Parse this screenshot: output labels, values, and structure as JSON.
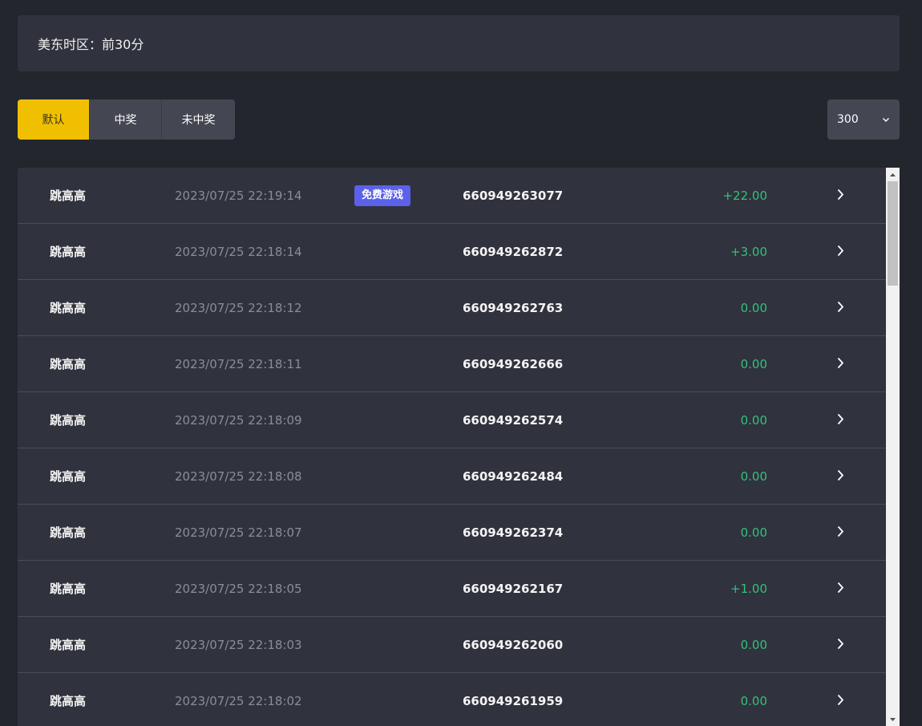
{
  "header": {
    "timezone_label": "美东时区：前30分"
  },
  "filters": {
    "tabs": [
      {
        "label": "默认",
        "active": true
      },
      {
        "label": "中奖",
        "active": false
      },
      {
        "label": "未中奖",
        "active": false
      }
    ]
  },
  "page_size": {
    "selected": "300",
    "icon": "chevron-down-icon"
  },
  "records": [
    {
      "game": "跳高高",
      "time": "2023/07/25 22:19:14",
      "badge": "免费游戏",
      "order_id": "660949263077",
      "amount": "+22.00"
    },
    {
      "game": "跳高高",
      "time": "2023/07/25 22:18:14",
      "badge": "",
      "order_id": "660949262872",
      "amount": "+3.00"
    },
    {
      "game": "跳高高",
      "time": "2023/07/25 22:18:12",
      "badge": "",
      "order_id": "660949262763",
      "amount": "0.00"
    },
    {
      "game": "跳高高",
      "time": "2023/07/25 22:18:11",
      "badge": "",
      "order_id": "660949262666",
      "amount": "0.00"
    },
    {
      "game": "跳高高",
      "time": "2023/07/25 22:18:09",
      "badge": "",
      "order_id": "660949262574",
      "amount": "0.00"
    },
    {
      "game": "跳高高",
      "time": "2023/07/25 22:18:08",
      "badge": "",
      "order_id": "660949262484",
      "amount": "0.00"
    },
    {
      "game": "跳高高",
      "time": "2023/07/25 22:18:07",
      "badge": "",
      "order_id": "660949262374",
      "amount": "0.00"
    },
    {
      "game": "跳高高",
      "time": "2023/07/25 22:18:05",
      "badge": "",
      "order_id": "660949262167",
      "amount": "+1.00"
    },
    {
      "game": "跳高高",
      "time": "2023/07/25 22:18:03",
      "badge": "",
      "order_id": "660949262060",
      "amount": "0.00"
    },
    {
      "game": "跳高高",
      "time": "2023/07/25 22:18:02",
      "badge": "",
      "order_id": "660949261959",
      "amount": "0.00"
    }
  ],
  "colors": {
    "background": "#24262e",
    "panel": "#30323d",
    "accent_active_tab": "#f0c000",
    "amount_green": "#35c07a",
    "badge_purple": "#5b61e8"
  }
}
